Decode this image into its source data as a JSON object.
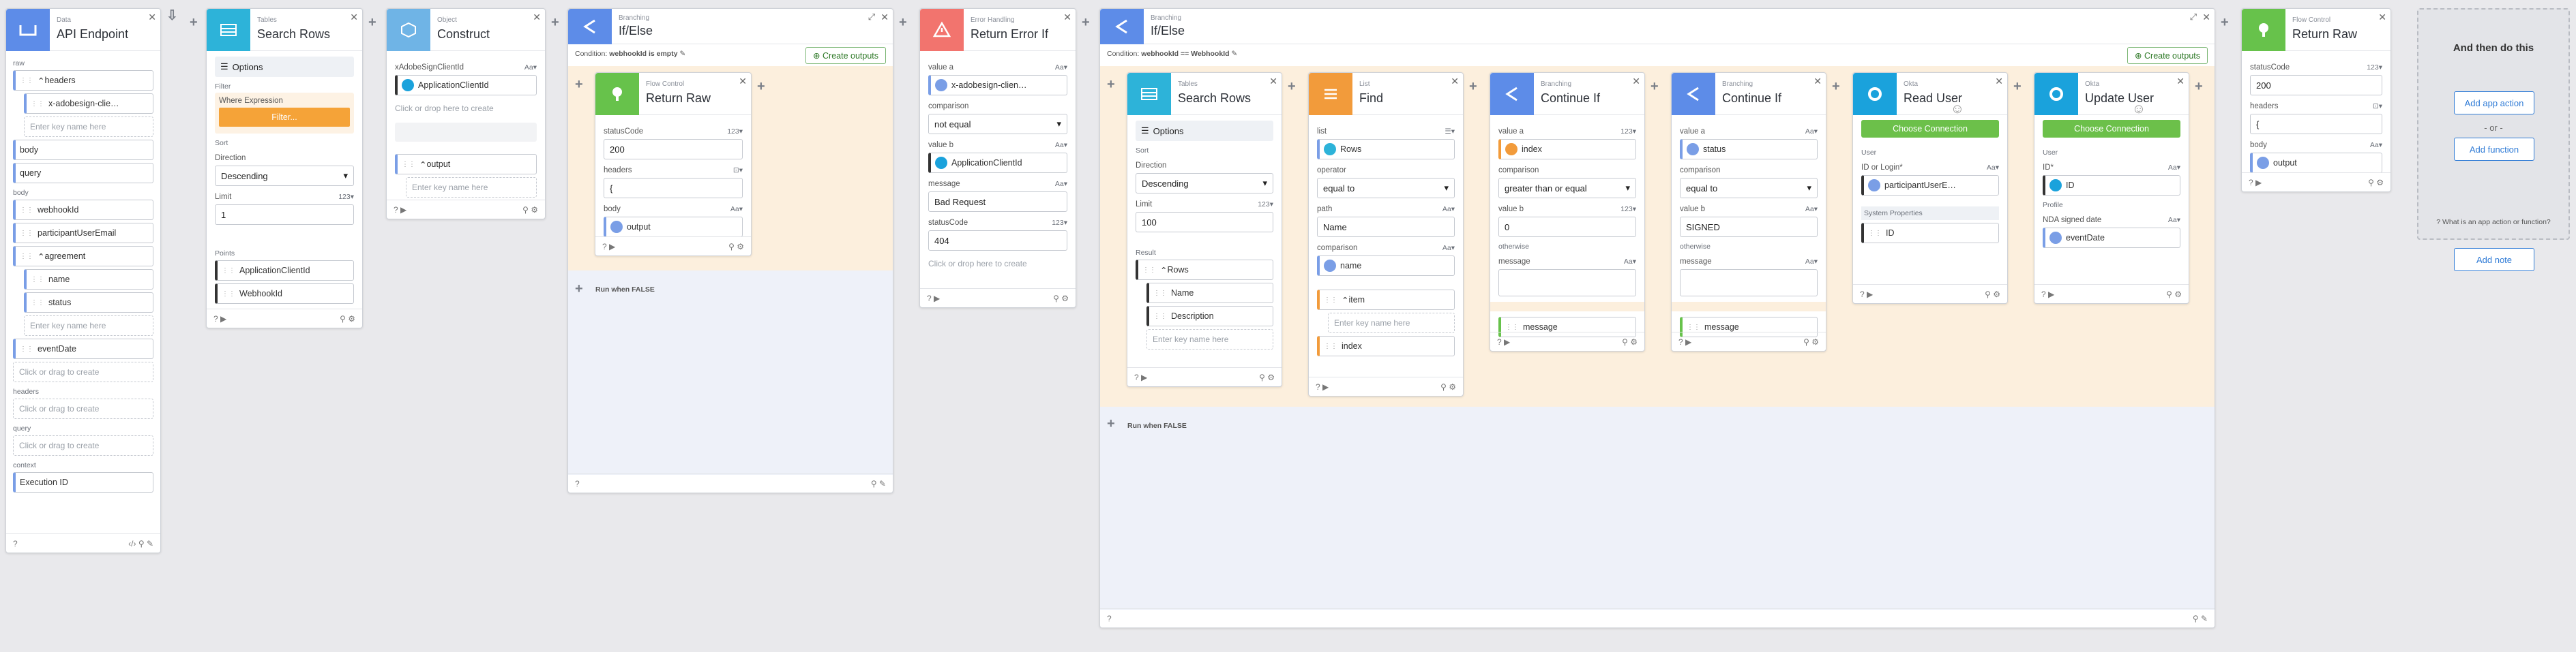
{
  "colors": {
    "blue": "#5d8ce8",
    "teal": "#2db3d9",
    "lightblue": "#6fb4e6",
    "orange_block": "#f29b3b",
    "red": "#f2746e",
    "green": "#67c24b",
    "okta": "#1aa2dc"
  },
  "cards": {
    "api": {
      "cat": "Data",
      "title": "API Endpoint",
      "icon": "bracket-icon",
      "items": [
        "raw",
        "headers",
        "x-adobesign-clie…",
        "Enter key name here",
        "body",
        "query",
        "body",
        "webhookId",
        "participantUserEmail",
        "agreement",
        "name",
        "status",
        "Enter key name here",
        "eventDate",
        "Click or drag to create",
        "headers",
        "Click or drag to create",
        "query",
        "Click or drag to create",
        "context",
        "Execution ID"
      ]
    },
    "search1": {
      "cat": "Tables",
      "title": "Search Rows",
      "options": "Options",
      "filter": "Filter",
      "where": "Where Expression",
      "filter_btn": "Filter...",
      "sort": "Sort",
      "direction": "Direction",
      "dir_val": "Descending",
      "limit": "Limit",
      "limit_val": "1",
      "points": "Points",
      "p1": "ApplicationClientId",
      "p2": "WebhookId"
    },
    "construct": {
      "cat": "Object",
      "title": "Construct",
      "f1": "xAdobeSignClientId",
      "v1": "ApplicationClientId",
      "ph": "Click or drop here to create",
      "out": "output",
      "enter": "Enter key name here"
    },
    "ifelse1": {
      "cat": "Branching",
      "title": "If/Else",
      "cond_label": "Condition:",
      "cond": "webhookId is empty",
      "create": "Create outputs",
      "false": "Run when FALSE"
    },
    "ret1": {
      "cat": "Flow Control",
      "title": "Return Raw",
      "f1": "statusCode",
      "v1": "200",
      "f2": "headers",
      "v2": "{",
      "f3": "body",
      "v3": "output"
    },
    "err": {
      "cat": "Error Handling",
      "title": "Return Error If",
      "fa": "value a",
      "va": "x-adobesign-clien…",
      "fc": "comparison",
      "vc": "not equal",
      "fb": "value b",
      "vb": "ApplicationClientId",
      "fm": "message",
      "vm": "Bad Request",
      "fs": "statusCode",
      "vs": "404",
      "ph": "Click or drop here to create"
    },
    "ifelse2": {
      "cat": "Branching",
      "title": "If/Else",
      "cond_label": "Condition:",
      "cond": "webhookId == WebhookId",
      "create": "Create outputs",
      "false": "Run when FALSE"
    },
    "search2": {
      "cat": "Tables",
      "title": "Search Rows",
      "options": "Options",
      "sort": "Sort",
      "direction": "Direction",
      "dir_val": "Descending",
      "limit": "Limit",
      "limit_val": "100",
      "result": "Result",
      "rows": "Rows",
      "r1": "Name",
      "r2": "Description",
      "r3": "Enter key name here"
    },
    "find": {
      "cat": "List",
      "title": "Find",
      "list": "list",
      "rows": "Rows",
      "op": "operator",
      "op_val": "equal to",
      "path": "path",
      "path_val": "Name",
      "cmp": "comparison",
      "cmp_val": "name",
      "item": "item",
      "enter": "Enter key name here",
      "index": "index"
    },
    "cont1": {
      "cat": "Branching",
      "title": "Continue If",
      "fa": "value a",
      "va": "index",
      "fc": "comparison",
      "vc": "greater than or equal",
      "fb": "value b",
      "vb": "0",
      "fo": "otherwise",
      "fm": "message",
      "out": "message"
    },
    "cont2": {
      "cat": "Branching",
      "title": "Continue If",
      "fa": "value a",
      "va": "status",
      "fc": "comparison",
      "vc": "equal to",
      "fb": "value b",
      "vb": "SIGNED",
      "fo": "otherwise",
      "fm": "message",
      "out": "message"
    },
    "read": {
      "cat": "Okta",
      "title": "Read User",
      "conn": "Choose Connection",
      "user": "User",
      "id": "ID or Login*",
      "idv": "participantUserE…",
      "sys": "System Properties",
      "sysv": "ID"
    },
    "update": {
      "cat": "Okta",
      "title": "Update User",
      "conn": "Choose Connection",
      "user": "User",
      "id": "ID*",
      "idv": "ID",
      "prof": "Profile",
      "nda": "NDA signed date",
      "ndav": "eventDate"
    },
    "ret2": {
      "cat": "Flow Control",
      "title": "Return Raw",
      "f1": "statusCode",
      "v1": "200",
      "f2": "headers",
      "v2": "{",
      "f3": "body",
      "v3": "output"
    },
    "next": {
      "title": "And then do this",
      "app": "Add app action",
      "or": "- or -",
      "func": "Add function",
      "q": "What is an app action or function?",
      "note": "Add note"
    }
  }
}
